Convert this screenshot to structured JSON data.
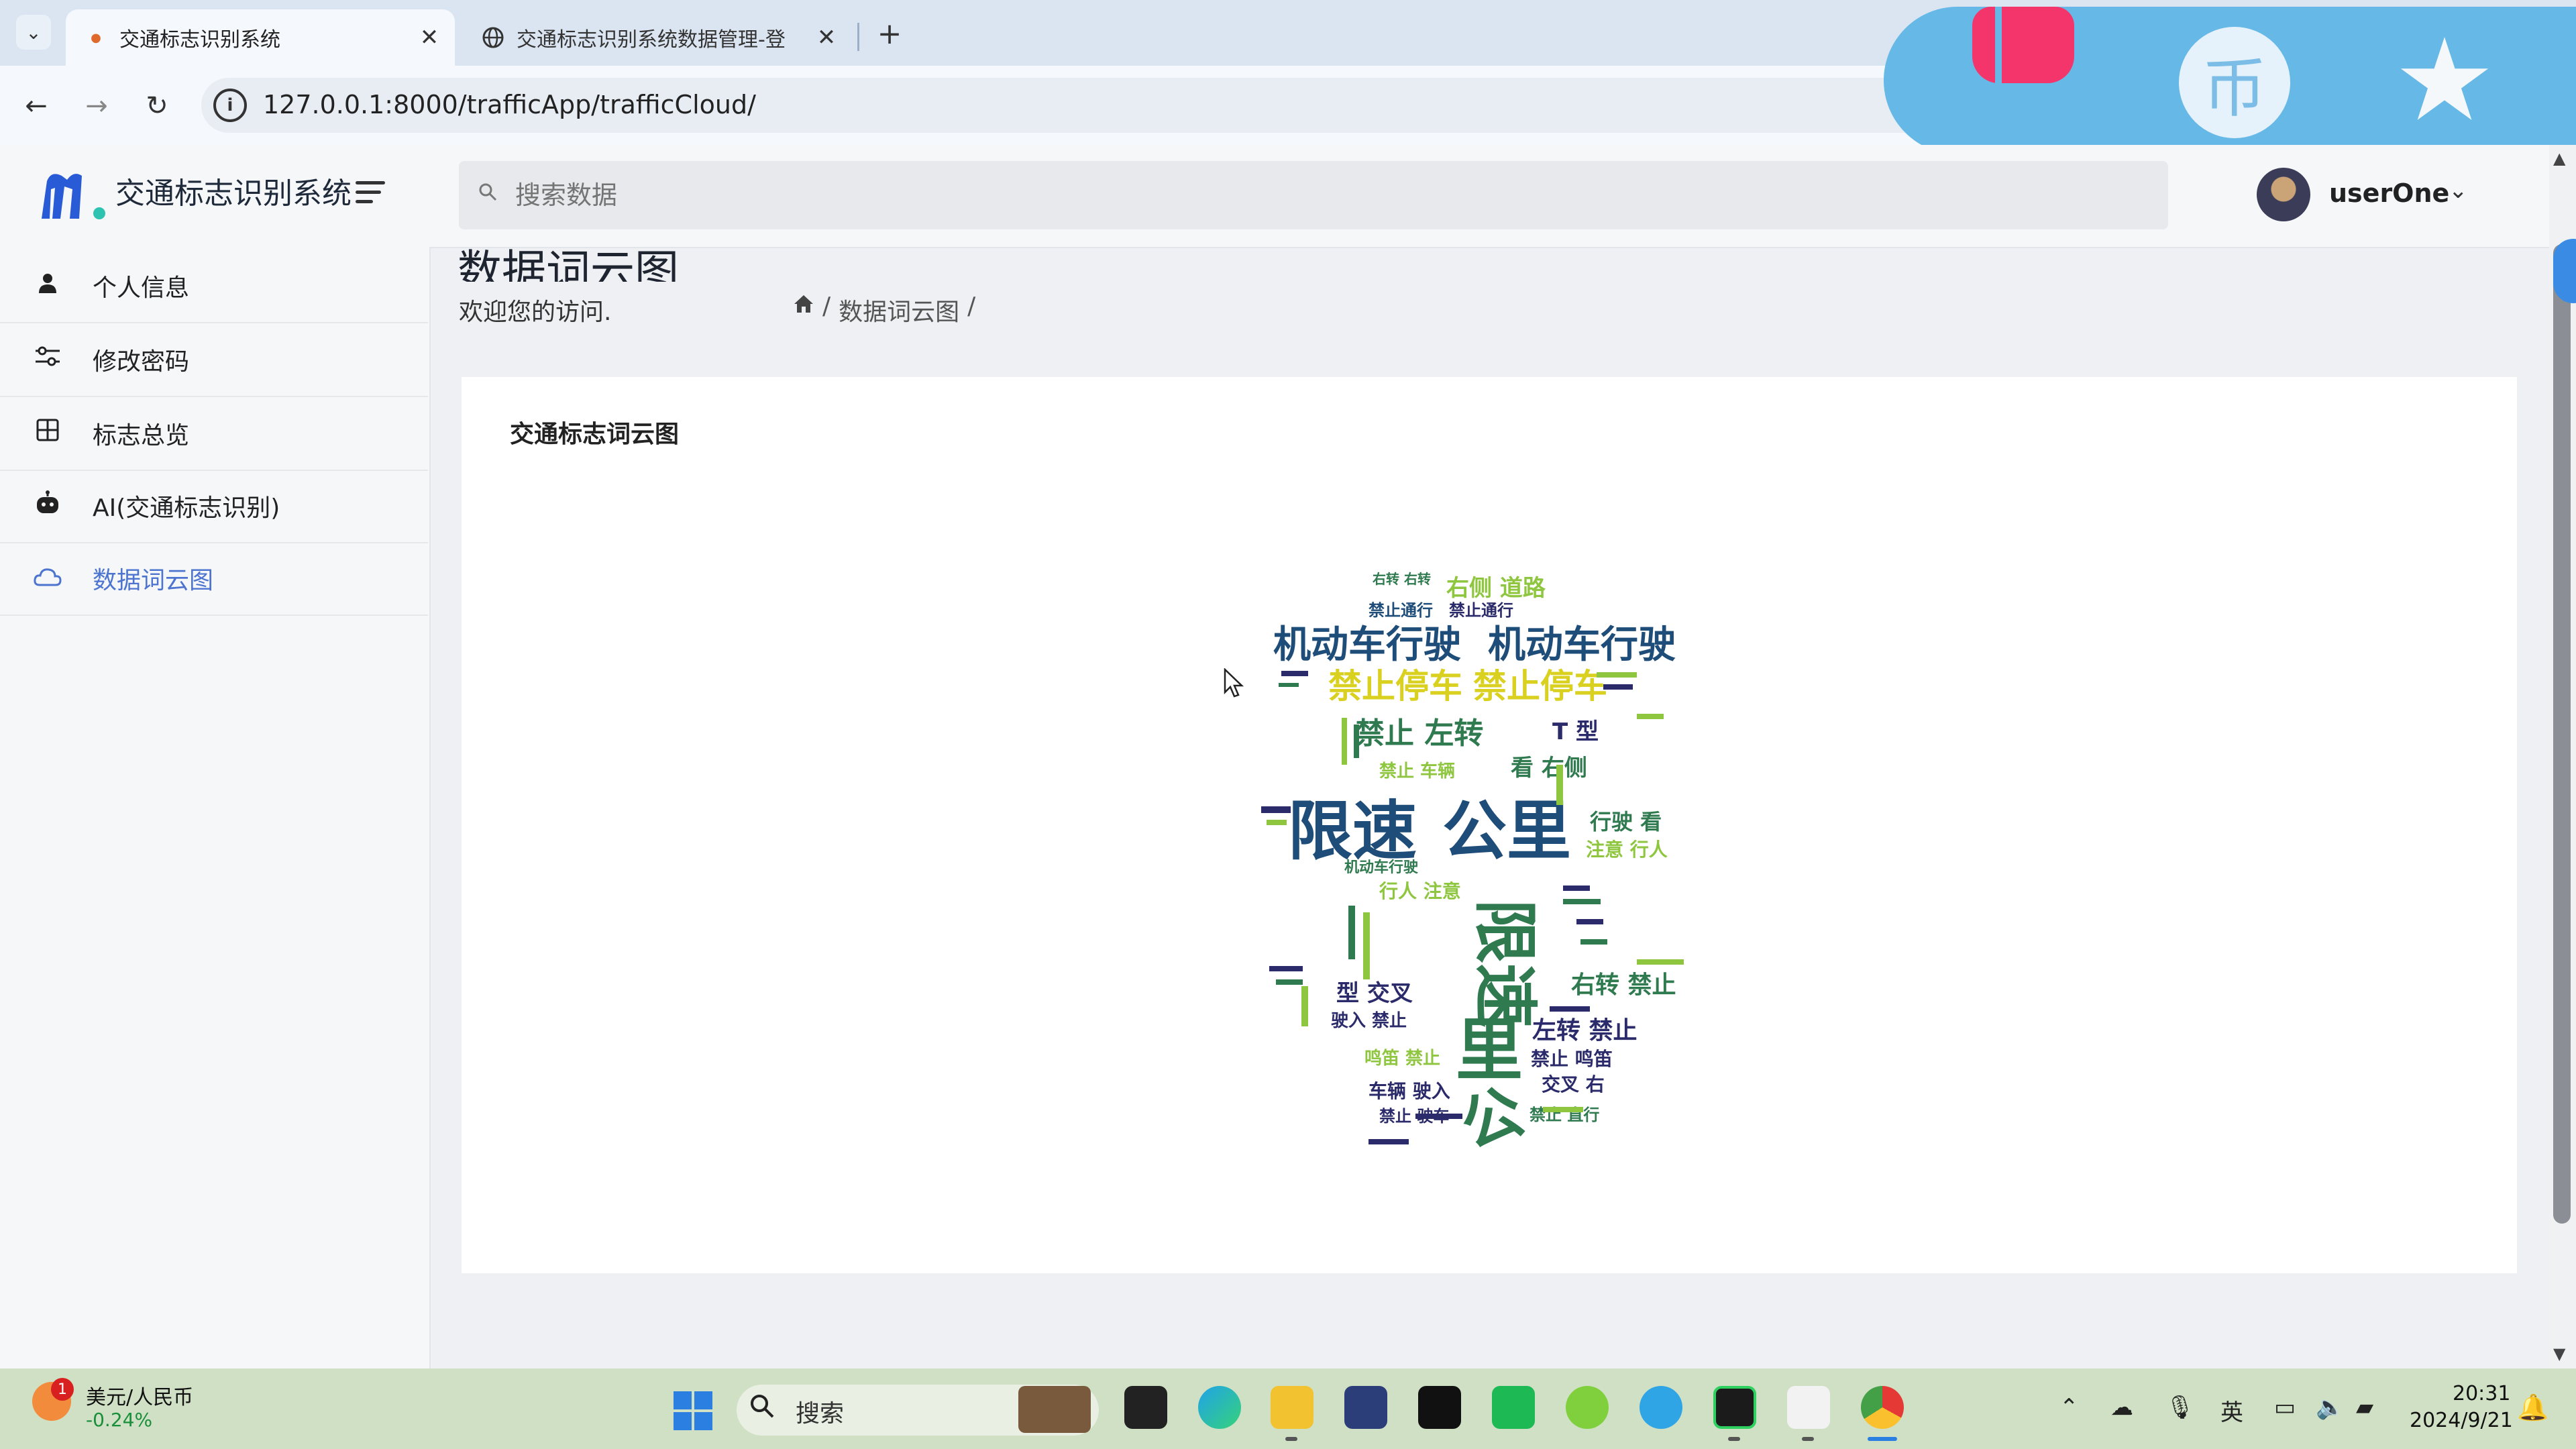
{
  "browser": {
    "tabs": [
      {
        "title": "交通标志识别系统",
        "active": true
      },
      {
        "title": "交通标志识别系统数据管理-登",
        "active": false
      }
    ],
    "url": "127.0.0.1:8000/trafficApp/trafficCloud/"
  },
  "overlay_widget": {
    "center_glyph": "币",
    "icons": [
      "thumbs-up-icon",
      "coin-icon",
      "star-icon"
    ]
  },
  "header": {
    "app_name": "交通标志识别系统",
    "search_placeholder": "搜索数据",
    "username": "userOne"
  },
  "sidebar": {
    "items": [
      {
        "label": "个人信息",
        "icon": "user-icon",
        "active": false
      },
      {
        "label": "修改密码",
        "icon": "sliders-icon",
        "active": false
      },
      {
        "label": "标志总览",
        "icon": "grid-icon",
        "active": false
      },
      {
        "label": "AI(交通标志识别)",
        "icon": "robot-icon",
        "active": false
      },
      {
        "label": "数据词云图",
        "icon": "cloud-icon",
        "active": true
      }
    ]
  },
  "main": {
    "page_title": "数据词云图",
    "welcome": "欢迎您的访问.",
    "breadcrumb": [
      "数据词云图"
    ],
    "card_title": "交通标志词云图"
  },
  "wordcloud": {
    "words": [
      {
        "text": "右转 右转",
        "color": "#2f7a4f"
      },
      {
        "text": "右侧 道路",
        "color": "#8fc63f"
      },
      {
        "text": "禁止通行",
        "color": "#1f4d7a"
      },
      {
        "text": "禁止通行",
        "color": "#2b2b6b"
      },
      {
        "text": "机动车行驶",
        "color": "#1f4d7a"
      },
      {
        "text": "机动车行驶",
        "color": "#1f4d7a"
      },
      {
        "text": "禁止停车",
        "color": "#d9d020"
      },
      {
        "text": "禁止停车",
        "color": "#d9d020"
      },
      {
        "text": "禁止 左转",
        "color": "#2f7a4f"
      },
      {
        "text": "T 型",
        "color": "#2b2b6b"
      },
      {
        "text": "禁止 车辆",
        "color": "#8fc63f"
      },
      {
        "text": "看 右侧",
        "color": "#2f7a4f"
      },
      {
        "text": "限速",
        "color": "#1f4d7a"
      },
      {
        "text": "公里",
        "color": "#1f4d7a"
      },
      {
        "text": "行驶 看",
        "color": "#2f7a4f"
      },
      {
        "text": "注意 行人",
        "color": "#8fc63f"
      },
      {
        "text": "机动车行驶",
        "color": "#2f7a4f"
      },
      {
        "text": "行人 注意",
        "color": "#8fc63f"
      },
      {
        "text": "限速",
        "color": "#2f7a4f"
      },
      {
        "text": "右转 禁止",
        "color": "#2f7a4f"
      },
      {
        "text": "型 交叉",
        "color": "#2b2b6b"
      },
      {
        "text": "驶入 禁止",
        "color": "#2b2b6b"
      },
      {
        "text": "左转 禁止",
        "color": "#2b2b6b"
      },
      {
        "text": "鸣笛 禁止",
        "color": "#8fc63f"
      },
      {
        "text": "禁止 鸣笛",
        "color": "#2b2b6b"
      },
      {
        "text": "交叉 右",
        "color": "#2b2b6b"
      },
      {
        "text": "车辆 驶入",
        "color": "#2b2b6b"
      },
      {
        "text": "禁止 驶车",
        "color": "#2b2b6b"
      },
      {
        "text": "禁止 直行",
        "color": "#2f7a4f"
      },
      {
        "text": "里",
        "color": "#2f7a4f"
      },
      {
        "text": "公",
        "color": "#2f7a4f"
      }
    ]
  },
  "taskbar": {
    "stock_name": "美元/人民币",
    "stock_change": "-0.24%",
    "badge_count": "1",
    "search_label": "搜索",
    "ime": "英",
    "time": "20:31",
    "date": "2024/9/21"
  }
}
